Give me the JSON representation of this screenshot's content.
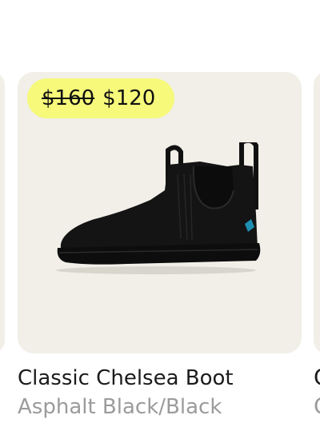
{
  "product": {
    "old_price": "$160",
    "new_price": "$120",
    "title": "Classic Chelsea Boot",
    "color": "Asphalt Black/Black",
    "image_icon": "chelsea-boot-image"
  },
  "next_product_peek": {
    "title": "C",
    "color": "C"
  },
  "colors": {
    "card_background": "#f1efe8",
    "badge_background": "#f6f97a",
    "title_text": "#1b1b1b",
    "muted_text": "#9b9b9b"
  }
}
